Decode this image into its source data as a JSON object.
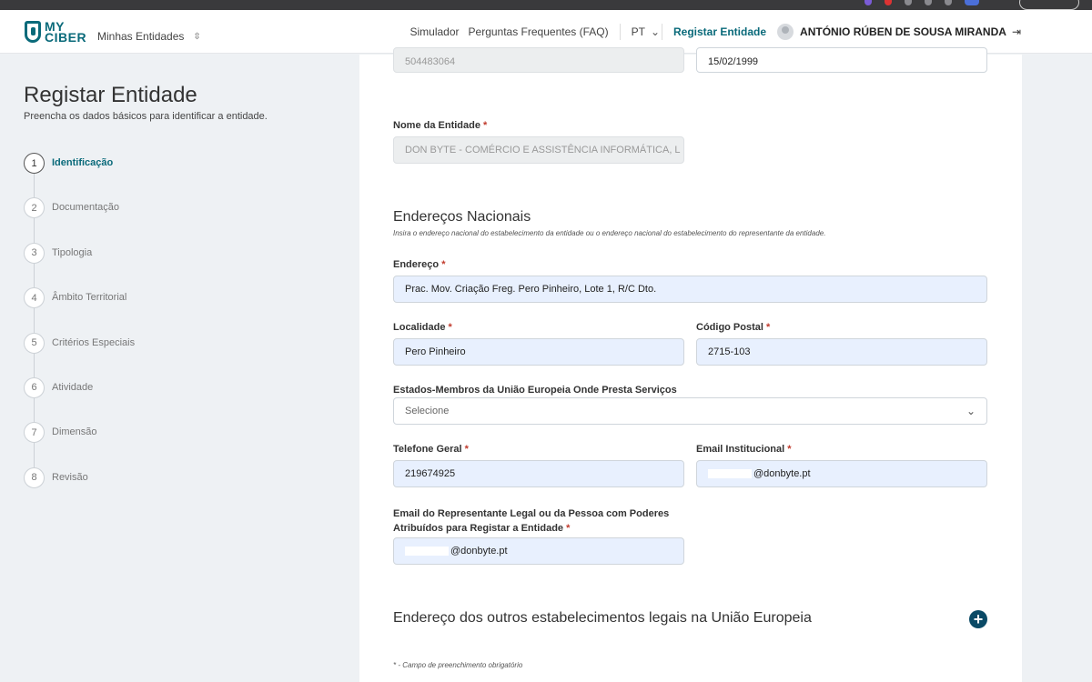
{
  "header": {
    "logo_top": "MY",
    "logo_bottom": "CIBER",
    "entities_selector": "Minhas Entidades",
    "nav_simulator": "Simulador",
    "nav_faq": "Perguntas Frequentes (FAQ)",
    "language": "PT",
    "nav_register": "Registar Entidade",
    "user_name": "ANTÓNIO RÚBEN DE SOUSA MIRANDA"
  },
  "sidebar": {
    "title": "Registar Entidade",
    "subtitle": "Preencha os dados básicos para identificar a entidade.",
    "steps": [
      {
        "num": "1",
        "label": "Identificação"
      },
      {
        "num": "2",
        "label": "Documentação"
      },
      {
        "num": "3",
        "label": "Tipologia"
      },
      {
        "num": "4",
        "label": "Âmbito Territorial"
      },
      {
        "num": "5",
        "label": "Critérios Especiais"
      },
      {
        "num": "6",
        "label": "Atividade"
      },
      {
        "num": "7",
        "label": "Dimensão"
      },
      {
        "num": "8",
        "label": "Revisão"
      }
    ]
  },
  "form": {
    "nif_value": "504483064",
    "date_value": "15/02/1999",
    "entity_name_label": "Nome da Entidade",
    "entity_name_value": "DON BYTE - COMÉRCIO E ASSISTÊNCIA INFORMÁTICA, L",
    "addresses_title": "Endereços Nacionais",
    "addresses_desc": "Insira o endereço nacional do estabelecimento da entidade ou o endereço nacional do estabelecimento do representante da entidade.",
    "address_label": "Endereço",
    "address_value": "Prac. Mov. Criação Freg. Pero Pinheiro, Lote 1, R/C Dto.",
    "locality_label": "Localidade",
    "locality_value": "Pero Pinheiro",
    "postal_label": "Código Postal",
    "postal_value": "2715-103",
    "eu_states_label": "Estados-Membros da União Europeia Onde Presta Serviços",
    "eu_states_placeholder": "Selecione",
    "phone_label": "Telefone Geral",
    "phone_value": "219674925",
    "email_inst_label": "Email Institucional",
    "email_inst_value": "@donbyte.pt",
    "email_rep_label_1": "Email do Representante Legal ou da Pessoa com Poderes",
    "email_rep_label_2": "Atribuídos para Registar a Entidade",
    "email_rep_value": "@donbyte.pt",
    "other_addresses_title": "Endereço dos outros estabelecimentos legais na União Europeia",
    "required_star": "*",
    "footnote": "* - Campo de preenchimento obrigatório"
  }
}
